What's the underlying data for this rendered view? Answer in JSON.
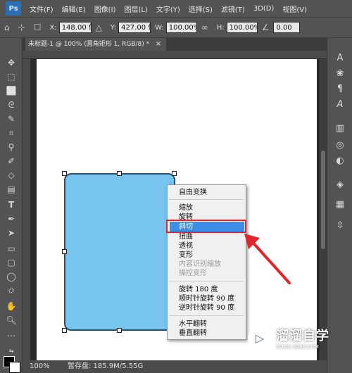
{
  "app": {
    "logo": "Ps"
  },
  "menubar": {
    "items": [
      "文件(F)",
      "编辑(E)",
      "图像(I)",
      "图层(L)",
      "文字(Y)",
      "选择(S)",
      "滤镜(T)",
      "3D(D)",
      "视图(V)"
    ]
  },
  "options": {
    "x_label": "X:",
    "x_value": "148.00 像素",
    "y_label": "Y:",
    "y_value": "427.00 像素",
    "w_label": "W:",
    "w_value": "100.00%",
    "h_label": "H:",
    "h_value": "100.00%",
    "angle_value": "0.00"
  },
  "document": {
    "tab_title": "未标题-1 @ 100% (圆角矩形 1, RGB/8) *",
    "close_glyph": "×"
  },
  "statusbar": {
    "zoom": "100%",
    "scratch": "暂存盘: 185.9M/5.55G"
  },
  "context_menu": {
    "items": [
      {
        "label": "自由变换",
        "enabled": true
      },
      {
        "label": "缩放",
        "enabled": true
      },
      {
        "label": "旋转",
        "enabled": true
      },
      {
        "label": "斜切",
        "enabled": true,
        "highlighted": true
      },
      {
        "label": "扭曲",
        "enabled": true
      },
      {
        "label": "透视",
        "enabled": true
      },
      {
        "label": "变形",
        "enabled": true
      },
      {
        "label": "内容识别缩放",
        "enabled": false
      },
      {
        "label": "操控变形",
        "enabled": false
      },
      {
        "label": "旋转 180 度",
        "enabled": true
      },
      {
        "label": "顺时针旋转 90 度",
        "enabled": true
      },
      {
        "label": "逆时针旋转 90 度",
        "enabled": true
      },
      {
        "label": "水平翻转",
        "enabled": true
      },
      {
        "label": "垂直翻转",
        "enabled": true
      }
    ]
  },
  "watermark": {
    "brand": "溜溜自学",
    "url": "ZIXUE.3D66.COM"
  },
  "colors": {
    "shape_fill": "#77c4ee",
    "highlight": "#3d8ee6",
    "annotation_red": "#e0262b"
  },
  "icons": {
    "tools": [
      "move-icon",
      "artboard-icon",
      "marquee-icon",
      "lasso-icon",
      "quick-select-icon",
      "crop-icon",
      "eyedropper-icon",
      "brush-icon",
      "eraser-icon",
      "gradient-icon",
      "type-icon",
      "pen-icon",
      "path-select-icon",
      "rectangle-icon",
      "rounded-rect-icon",
      "ellipse-icon",
      "custom-shape-icon",
      "hand-icon",
      "zoom-icon",
      "more-icon"
    ],
    "right_panel": [
      "type-tool-icon",
      "paragraph-icon",
      "character-icon",
      "glyph-icon",
      "history-icon",
      "cc-libraries-icon",
      "color-icon",
      "layers-icon",
      "channels-icon",
      "paths-icon"
    ]
  }
}
